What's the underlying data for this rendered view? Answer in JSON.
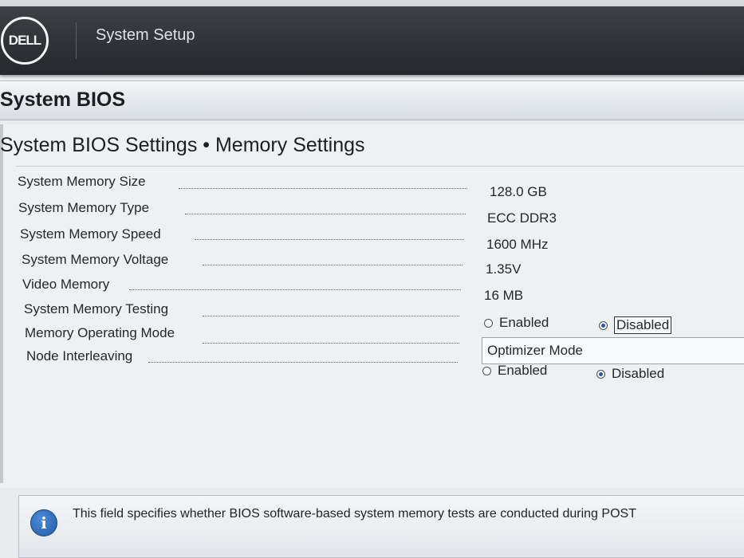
{
  "header": {
    "logo_text": "DELL",
    "app_title": "System Setup"
  },
  "banner": {
    "title": "System BIOS"
  },
  "page": {
    "title": "System BIOS Settings • Memory Settings"
  },
  "settings": [
    {
      "label": "System Memory Size",
      "value": "128.0 GB"
    },
    {
      "label": "System Memory Type",
      "value": "ECC DDR3"
    },
    {
      "label": "System Memory Speed",
      "value": "1600 MHz"
    },
    {
      "label": "System Memory Voltage",
      "value": "1.35V"
    },
    {
      "label": "Video Memory",
      "value": "16 MB"
    },
    {
      "label": "System Memory Testing",
      "options": [
        "Enabled",
        "Disabled"
      ],
      "selected": "Disabled"
    },
    {
      "label": "Memory Operating Mode",
      "value": "Optimizer Mode"
    },
    {
      "label": "Node Interleaving",
      "options": [
        "Enabled",
        "Disabled"
      ],
      "selected": "Disabled"
    }
  ],
  "help": {
    "icon": "info-icon",
    "text": "This field specifies whether BIOS software-based system memory tests are conducted during POST"
  },
  "colors": {
    "header_bg": "#2f3337",
    "radio_selected": "#2a55b8",
    "info_icon": "#1d5ba8"
  }
}
